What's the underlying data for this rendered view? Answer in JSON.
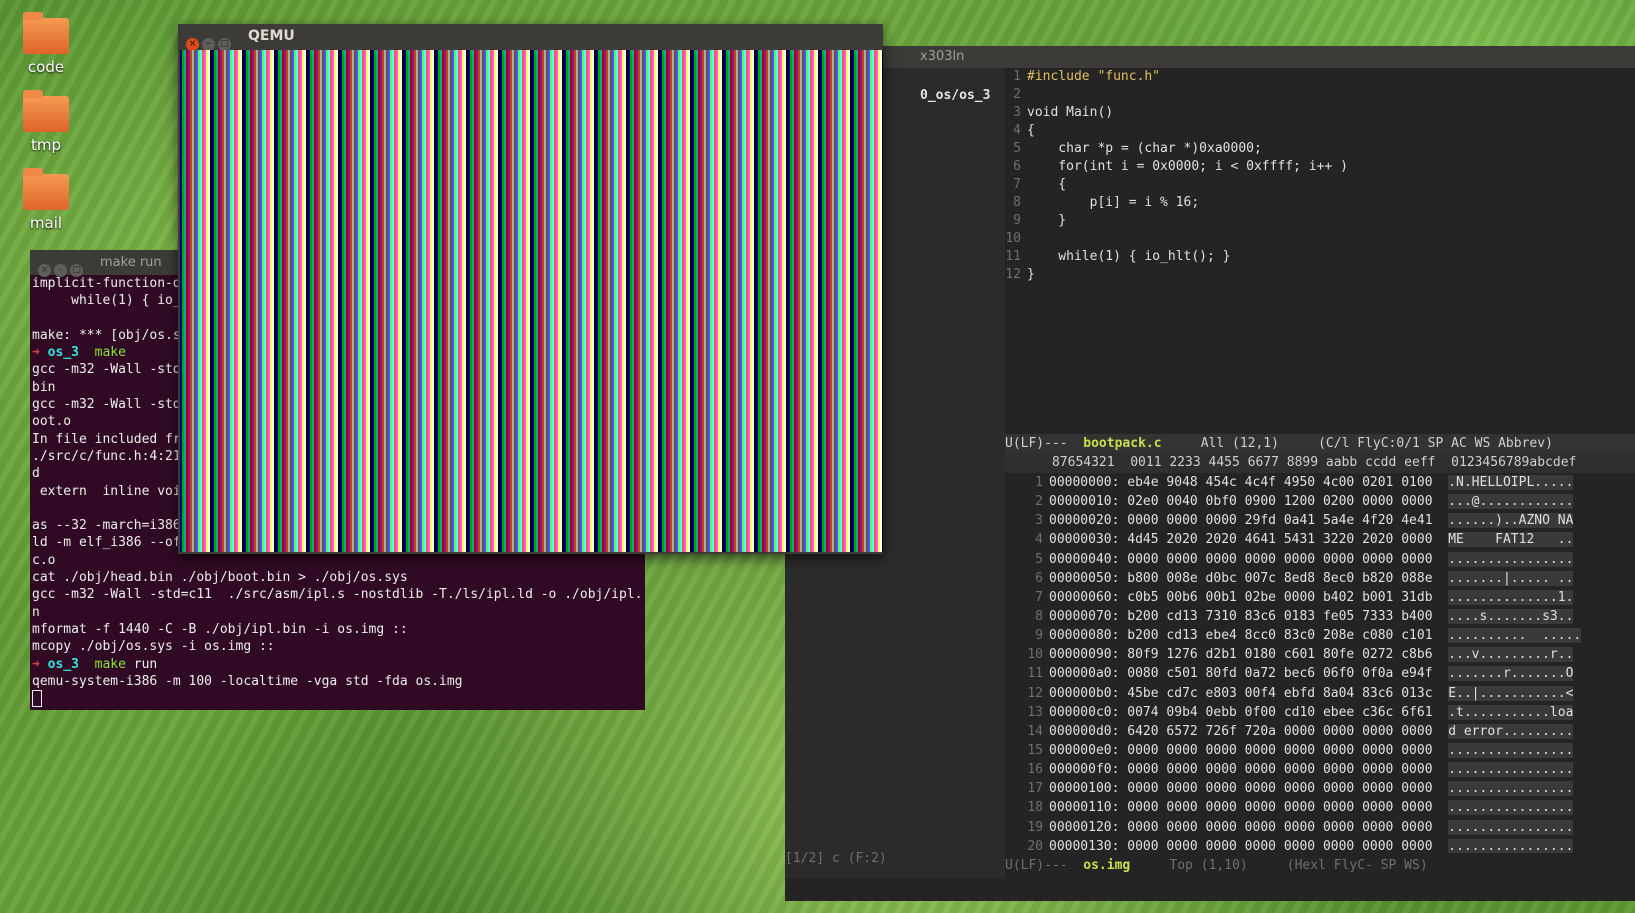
{
  "desktop": {
    "icons": [
      {
        "label": "code"
      },
      {
        "label": "tmp"
      },
      {
        "label": "mail"
      }
    ]
  },
  "qemu": {
    "title": "QEMU"
  },
  "terminal": {
    "title": "make run",
    "lines": [
      "implicit-function-d",
      "     while(1) { io_",
      "                    ^",
      "make: *** [obj/os.s",
      "PROMPT1",
      "gcc -m32 -Wall -std",
      "bin",
      "gcc -m32 -Wall -std",
      "oot.o",
      "In file included fr",
      "./src/c/func.h:4:21",
      "d",
      " extern  inline voi",
      "",
      "as --32 -march=i386",
      "ld -m elf_i386 --of",
      "c.o",
      "cat ./obj/head.bin ./obj/boot.bin > ./obj/os.sys",
      "gcc -m32 -Wall -std=c11  ./src/asm/ipl.s -nostdlib -T./ls/ipl.ld -o ./obj/ipl.bi",
      "n",
      "mformat -f 1440 -C -B ./obj/ipl.bin -i os.img ::",
      "mcopy ./obj/os.sys -i os.img ::",
      "PROMPT2",
      "qemu-system-i386 -m 100 -localtime -vga std -fda os.img"
    ],
    "prompt1": {
      "arrow": "➜",
      "dir": "os_3",
      "cmd": "make"
    },
    "prompt2": {
      "arrow": "➜",
      "dir": "os_3",
      "cmd": "make",
      "arg": "run"
    }
  },
  "emacs": {
    "title_fragment": "x303ln",
    "left_path": "0_os/os_3",
    "left_status": "[1/2] c (F:2)",
    "code": [
      "#include \"func.h\"",
      "",
      "void Main()",
      "{",
      "    char *p = (char *)0xa0000;",
      "    for(int i = 0x0000; i < 0xffff; i++ )",
      "    {",
      "        p[i] = i % 16;",
      "    }",
      "",
      "    while(1) { io_hlt(); }",
      "}"
    ],
    "modeline_top": {
      "prefix": "U(LF)---  ",
      "buffer": "bootpack.c",
      "rest": "     All (12,1)     (C/l FlyC:0/1 SP AC WS Abbrev)"
    },
    "hex_header": "      87654321  0011 2233 4455 6677 8899 aabb ccdd eeff  0123456789abcdef",
    "hex_rows": [
      [
        "00000000:",
        "eb4e 9048 454c 4c4f 4950 4c00 0201 0100",
        ".N.HELLOIPL....."
      ],
      [
        "00000010:",
        "02e0 0040 0bf0 0900 1200 0200 0000 0000",
        "...@............"
      ],
      [
        "00000020:",
        "0000 0000 0000 29fd 0a41 5a4e 4f20 4e41",
        "......)..AZNO NA"
      ],
      [
        "00000030:",
        "4d45 2020 2020 4641 5431 3220 2020 0000",
        "ME    FAT12   .."
      ],
      [
        "00000040:",
        "0000 0000 0000 0000 0000 0000 0000 0000",
        "................"
      ],
      [
        "00000050:",
        "b800 008e d0bc 007c 8ed8 8ec0 b820 088e",
        ".......|..... .."
      ],
      [
        "00000060:",
        "c0b5 00b6 00b1 02be 0000 b402 b001 31db",
        "..............1."
      ],
      [
        "00000070:",
        "b200 cd13 7310 83c6 0183 fe05 7333 b400",
        "....s.......s3.."
      ],
      [
        "00000080:",
        "b200 cd13 ebe4 8cc0 83c0 208e c080 c101",
        "..........  ....."
      ],
      [
        "00000090:",
        "80f9 1276 d2b1 0180 c601 80fe 0272 c8b6",
        "...v.........r.."
      ],
      [
        "000000a0:",
        "0080 c501 80fd 0a72 bec6 06f0 0f0a e94f",
        ".......r.......O"
      ],
      [
        "000000b0:",
        "45be cd7c e803 00f4 ebfd 8a04 83c6 013c",
        "E..|...........<"
      ],
      [
        "000000c0:",
        "0074 09b4 0ebb 0f00 cd10 ebee c36c 6f61",
        ".t...........loa"
      ],
      [
        "000000d0:",
        "6420 6572 726f 720a 0000 0000 0000 0000",
        "d error........."
      ],
      [
        "000000e0:",
        "0000 0000 0000 0000 0000 0000 0000 0000",
        "................"
      ],
      [
        "000000f0:",
        "0000 0000 0000 0000 0000 0000 0000 0000",
        "................"
      ],
      [
        "00000100:",
        "0000 0000 0000 0000 0000 0000 0000 0000",
        "................"
      ],
      [
        "00000110:",
        "0000 0000 0000 0000 0000 0000 0000 0000",
        "................"
      ],
      [
        "00000120:",
        "0000 0000 0000 0000 0000 0000 0000 0000",
        "................"
      ],
      [
        "00000130:",
        "0000 0000 0000 0000 0000 0000 0000 0000",
        "................"
      ]
    ],
    "modeline_bottom": {
      "prefix": "U(LF)---  ",
      "buffer": "os.img",
      "rest": "     Top (1,10)     (Hexl FlyC- SP WS)"
    }
  }
}
